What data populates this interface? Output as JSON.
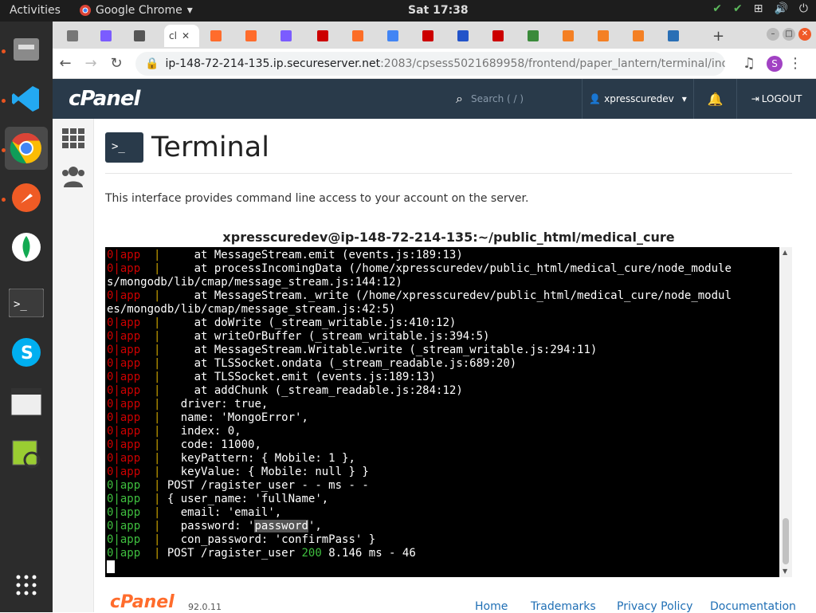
{
  "system": {
    "activities": "Activities",
    "app_name": "Google Chrome",
    "clock": "Sat 17:38"
  },
  "browser": {
    "active_tab_label": "cl",
    "url_host": "ip-148-72-214-135.ip.secureserver.net",
    "url_rest": ":2083/cpsess5021689958/frontend/paper_lantern/terminal/index...",
    "profile_initial": "S"
  },
  "cpanel": {
    "logo": "cPanel",
    "search_placeholder": "Search ( / )",
    "username": "xpresscuredev",
    "logout": "LOGOUT"
  },
  "page": {
    "title": "Terminal",
    "description": "This interface provides command line access to your account on the server.",
    "prompt": "xpresscuredev@ip-148-72-214-135:~/public_html/medical_cure"
  },
  "terminal": {
    "lines": [
      {
        "c": "r",
        "t": "     at MessageStream.emit (events.js:189:13)"
      },
      {
        "c": "r",
        "t": "     at processIncomingData (/home/xpresscuredev/public_html/medical_cure/node_module"
      },
      {
        "c": "w",
        "t": "s/mongodb/lib/cmap/message_stream.js:144:12)"
      },
      {
        "c": "r",
        "t": "     at MessageStream._write (/home/xpresscuredev/public_html/medical_cure/node_modul"
      },
      {
        "c": "w",
        "t": "es/mongodb/lib/cmap/message_stream.js:42:5)"
      },
      {
        "c": "r",
        "t": "     at doWrite (_stream_writable.js:410:12)"
      },
      {
        "c": "r",
        "t": "     at writeOrBuffer (_stream_writable.js:394:5)"
      },
      {
        "c": "r",
        "t": "     at MessageStream.Writable.write (_stream_writable.js:294:11)"
      },
      {
        "c": "r",
        "t": "     at TLSSocket.ondata (_stream_readable.js:689:20)"
      },
      {
        "c": "r",
        "t": "     at TLSSocket.emit (events.js:189:13)"
      },
      {
        "c": "r",
        "t": "     at addChunk (_stream_readable.js:284:12)"
      },
      {
        "c": "r",
        "t": "   driver: true,"
      },
      {
        "c": "r",
        "t": "   name: 'MongoError',"
      },
      {
        "c": "r",
        "t": "   index: 0,"
      },
      {
        "c": "r",
        "t": "   code: 11000,"
      },
      {
        "c": "r",
        "t": "   keyPattern: { Mobile: 1 },"
      },
      {
        "c": "r",
        "t": "   keyValue: { Mobile: null } }"
      },
      {
        "c": "g",
        "t": " POST /ragister_user - - ms - -"
      },
      {
        "c": "g",
        "t": " { user_name: 'fullName',"
      },
      {
        "c": "g",
        "t": "   email: 'email',"
      },
      {
        "c": "g",
        "t": "   password: 'password',"
      },
      {
        "c": "g",
        "t": "   con_password: 'confirmPass' }"
      },
      {
        "c": "g",
        "t": " POST /ragister_user 200 8.146 ms - 46"
      }
    ],
    "prefix_num": "0",
    "prefix_app": "app",
    "prefix_bar": "|"
  },
  "footer": {
    "logo": "cPanel",
    "version": "92.0.11",
    "links": [
      "Home",
      "Trademarks",
      "Privacy Policy",
      "Documentation"
    ]
  },
  "colors": {
    "cpanel_header": "#293a4a",
    "terminal_bg": "#000000",
    "error_red": "#cd0000",
    "ok_green": "#3fbf3f",
    "link_blue": "#1f6fb5",
    "brand_orange": "#ff6c2c"
  }
}
